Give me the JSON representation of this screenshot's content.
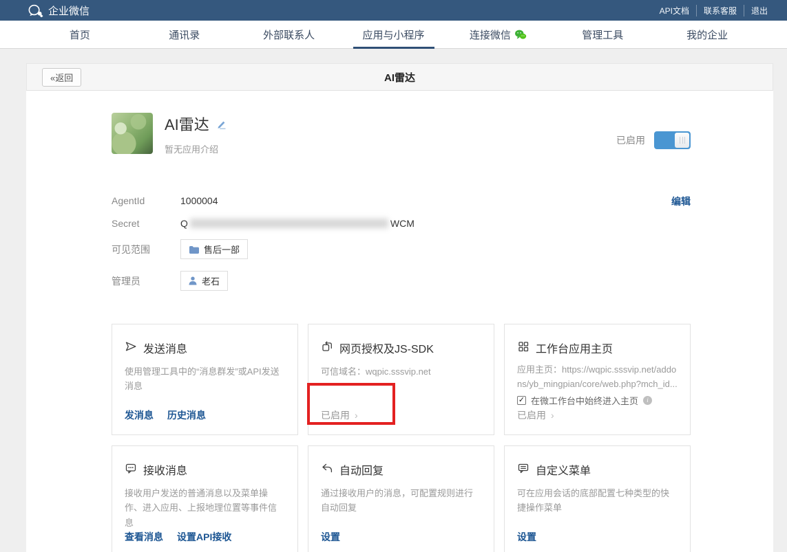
{
  "topbar": {
    "brand": "企业微信",
    "links": [
      {
        "label": "API文档"
      },
      {
        "label": "联系客服"
      },
      {
        "label": "退出"
      }
    ]
  },
  "nav": {
    "items": [
      {
        "label": "首页"
      },
      {
        "label": "通讯录"
      },
      {
        "label": "外部联系人"
      },
      {
        "label": "应用与小程序",
        "active": true
      },
      {
        "label": "连接微信"
      },
      {
        "label": "管理工具"
      },
      {
        "label": "我的企业"
      }
    ]
  },
  "subheader": {
    "back": "«返回",
    "title": "AI雷达"
  },
  "app": {
    "name": "AI雷达",
    "desc": "暂无应用介绍",
    "status_label": "已启用"
  },
  "fields": {
    "agentid_label": "AgentId",
    "agentid_value": "1000004",
    "edit_link": "编辑",
    "secret_label": "Secret",
    "secret_prefix": "Q",
    "secret_suffix": "WCM",
    "scope_label": "可见范围",
    "scope_tag": "售后一部",
    "admin_label": "管理员",
    "admin_tag": "老石"
  },
  "cards": [
    {
      "title": "发送消息",
      "desc": "使用管理工具中的“消息群发”或API发送消息",
      "links": [
        "发消息",
        "历史消息"
      ]
    },
    {
      "title": "网页授权及JS-SDK",
      "desc": "可信域名：wqpic.sssvip.net",
      "status": "已启用",
      "chevron": "›"
    },
    {
      "title": "工作台应用主页",
      "desc": "应用主页：https://wqpic.sssvip.net/addons/yb_mingpian/core/web.php?mch_id...",
      "checkbox_label": "在微工作台中始终进入主页",
      "checkbox_mark": "✓",
      "info_mark": "i",
      "status": "已启用",
      "chevron": "›"
    },
    {
      "title": "接收消息",
      "desc": "接收用户发送的普通消息以及菜单操作、进入应用、上报地理位置等事件信息",
      "links": [
        "查看消息",
        "设置API接收"
      ]
    },
    {
      "title": "自动回复",
      "desc": "通过接收用户的消息，可配置规则进行自动回复",
      "links": [
        "设置"
      ]
    },
    {
      "title": "自定义菜单",
      "desc": "可在应用会话的底部配置七种类型的快捷操作菜单",
      "links": [
        "设置"
      ]
    }
  ],
  "colors": {
    "topbar_bg": "#35587e",
    "accent_blue": "#4a96d2",
    "link_blue": "#1d5693",
    "annotation_red": "#e32121",
    "wechat_green": "#3eb135"
  }
}
